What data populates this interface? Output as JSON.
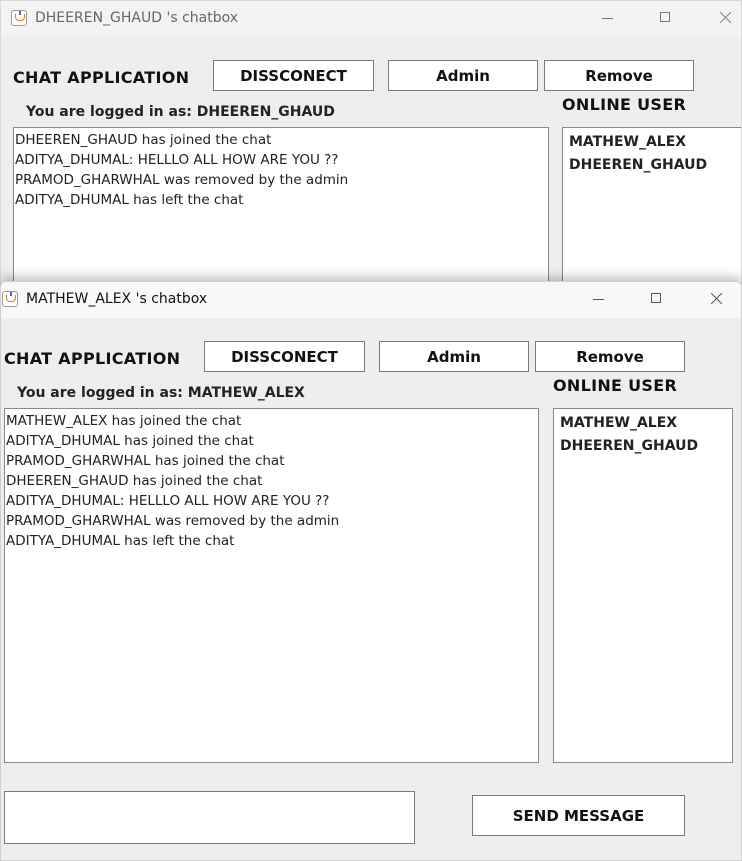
{
  "back_window": {
    "title": "DHEEREN_GHAUD 's chatbox",
    "app_title": "CHAT APPLICATION",
    "buttons": {
      "disconnect": "DISSCONECT",
      "admin": "Admin",
      "remove": "Remove"
    },
    "logged_in_text": "You are logged in as: DHEEREN_GHAUD",
    "online_title": "ONLINE USER",
    "messages": [
      "DHEEREN_GHAUD has joined the chat",
      "ADITYA_DHUMAL: HELLLO ALL HOW ARE YOU ??",
      "PRAMOD_GHARWHAL was removed by the admin",
      "ADITYA_DHUMAL has left the chat"
    ],
    "online_users": [
      "MATHEW_ALEX",
      "DHEEREN_GHAUD"
    ]
  },
  "front_window": {
    "title": "MATHEW_ALEX 's chatbox",
    "app_title": "CHAT APPLICATION",
    "buttons": {
      "disconnect": "DISSCONECT",
      "admin": "Admin",
      "remove": "Remove",
      "send": "SEND MESSAGE"
    },
    "logged_in_text": "You are logged in as: MATHEW_ALEX",
    "online_title": "ONLINE USER",
    "messages": [
      "MATHEW_ALEX has joined the chat",
      "ADITYA_DHUMAL has joined the chat",
      "PRAMOD_GHARWHAL has joined the chat",
      "DHEEREN_GHAUD has joined the chat",
      "ADITYA_DHUMAL: HELLLO ALL HOW ARE YOU ??",
      "PRAMOD_GHARWHAL was removed by the admin",
      "ADITYA_DHUMAL has left the chat"
    ],
    "online_users": [
      "MATHEW_ALEX",
      "DHEEREN_GHAUD"
    ],
    "message_input_value": ""
  },
  "icons": {
    "app_icon": "java-cup-icon",
    "minimize": "minimize-icon",
    "maximize": "maximize-icon",
    "close": "close-icon"
  }
}
